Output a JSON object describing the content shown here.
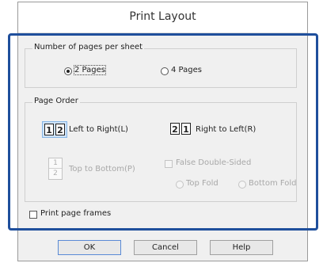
{
  "window": {
    "title": "Print Layout"
  },
  "pages_group": {
    "label": "Number of pages per sheet",
    "options": [
      {
        "label": "2 Pages",
        "checked": true
      },
      {
        "label": "4 Pages",
        "checked": false
      }
    ]
  },
  "order_group": {
    "label": "Page Order",
    "left_to_right": {
      "label": "Left to Right(L)",
      "digits": [
        "1",
        "2"
      ]
    },
    "right_to_left": {
      "label": "Right to Left(R)",
      "digits": [
        "2",
        "1"
      ]
    },
    "top_to_bottom": {
      "label": "Top to Bottom(P)",
      "digits": [
        "1",
        "2"
      ]
    },
    "false_double_sided": {
      "label": "False Double-Sided"
    },
    "top_fold": {
      "label": "Top Fold"
    },
    "bottom_fold": {
      "label": "Bottom Fold"
    }
  },
  "print_frames": {
    "label": "Print page frames"
  },
  "buttons": {
    "ok": "OK",
    "cancel": "Cancel",
    "help": "Help"
  },
  "colors": {
    "highlight": "#1f4f9c",
    "selection": "#cfe3f8"
  }
}
